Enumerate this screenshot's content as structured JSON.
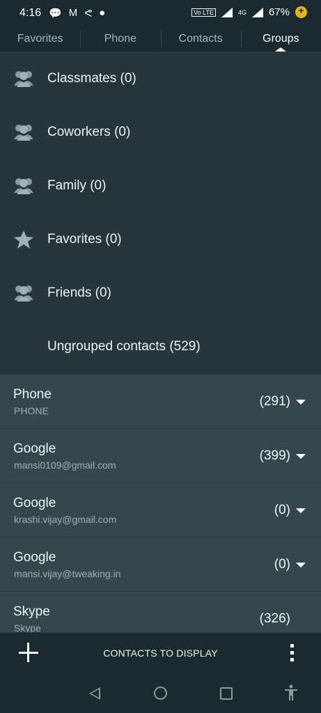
{
  "status_bar": {
    "time": "4:16",
    "notif_icons": [
      "chat-bubble-icon",
      "gmail-icon",
      "airtel-icon",
      "messenger-icon"
    ],
    "volte": "Vo LTE",
    "network": "4G",
    "battery": "67%"
  },
  "tabs": [
    {
      "label": "Favorites",
      "active": false
    },
    {
      "label": "Phone",
      "active": false
    },
    {
      "label": "Contacts",
      "active": false
    },
    {
      "label": "Groups",
      "active": true
    }
  ],
  "groups": [
    {
      "label": "Classmates (0)",
      "icon": "people-icon"
    },
    {
      "label": "Coworkers (0)",
      "icon": "people-icon"
    },
    {
      "label": "Family (0)",
      "icon": "people-icon"
    },
    {
      "label": "Favorites (0)",
      "icon": "star-icon"
    },
    {
      "label": "Friends (0)",
      "icon": "people-icon"
    },
    {
      "label": "Ungrouped contacts (529)",
      "icon": ""
    }
  ],
  "accounts": [
    {
      "name": "Phone",
      "sub": "PHONE",
      "count": "(291)"
    },
    {
      "name": "Google",
      "sub": "mansi0109@gmail.com",
      "count": "(399)"
    },
    {
      "name": "Google",
      "sub": "krashi.vijay@gmail.com",
      "count": "(0)"
    },
    {
      "name": "Google",
      "sub": "mansi.vijay@tweaking.in",
      "count": "(0)"
    },
    {
      "name": "Skype",
      "sub": "Skype",
      "count": "(326)"
    }
  ],
  "bottom_bar": {
    "label": "CONTACTS TO DISPLAY"
  },
  "colors": {
    "background": "#1e2e33",
    "groups_bg": "#26363b",
    "accounts_bg": "#34474c",
    "battery_accent": "#e7b324"
  }
}
